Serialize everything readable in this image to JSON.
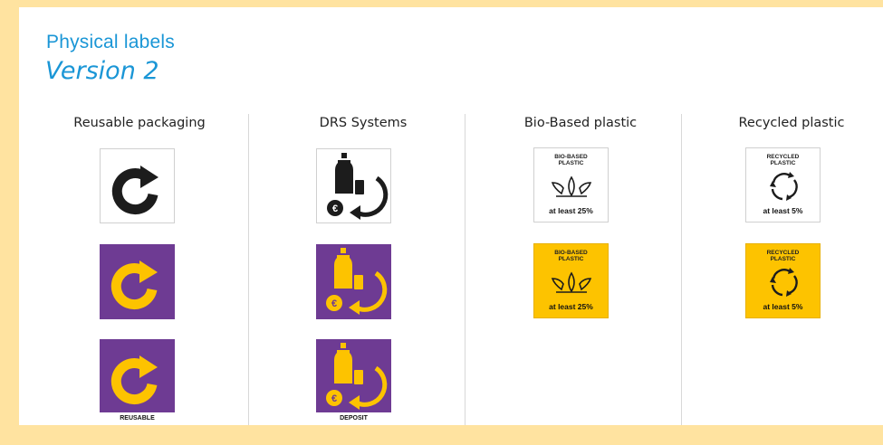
{
  "title": "Physical labels",
  "subtitle": "Version 2",
  "columns": [
    {
      "heading": "Reusable packaging",
      "strip_label": "REUSABLE"
    },
    {
      "heading": "DRS Systems",
      "strip_label": "DEPOSIT"
    },
    {
      "heading": "Bio-Based plastic",
      "label_top": "BIO-BASED PLASTIC",
      "label_bottom": "at least 25%"
    },
    {
      "heading": "Recycled plastic",
      "label_top": "RECYCLED PLASTIC",
      "label_bottom": "at least 5%"
    }
  ],
  "colors": {
    "title": "#1a96d6",
    "purple": "#6e3b93",
    "yellow": "#fdc300",
    "frame": "#ffe3a0"
  },
  "icons": [
    "reuse-arrow-icon",
    "bottle-deposit-icon",
    "leaf-icon",
    "recycle-circle-icon",
    "euro-icon"
  ]
}
